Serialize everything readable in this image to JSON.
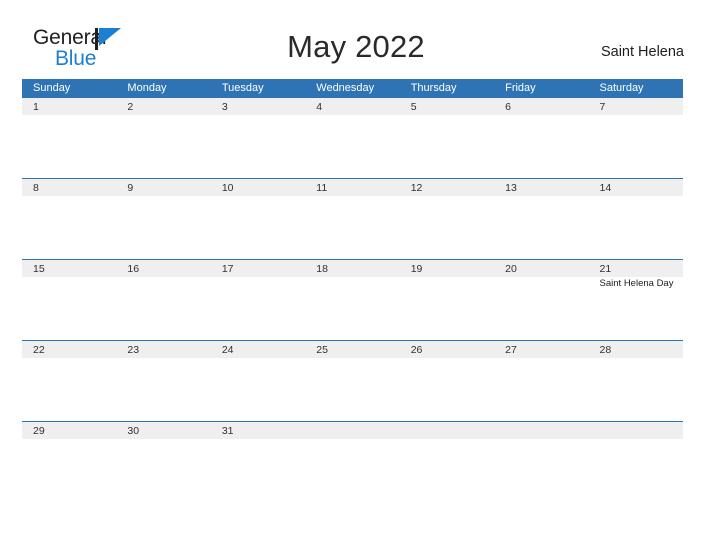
{
  "brand": {
    "name_top": "General",
    "name_bottom": "Blue",
    "flag_color": "#1b7fd4",
    "text_color": "#231f20"
  },
  "header": {
    "title": "May 2022",
    "region": "Saint Helena"
  },
  "theme": {
    "header_blue": "#2e74b5",
    "band_gray": "#efefef",
    "text_dark": "#303030"
  },
  "calendar": {
    "weekdays": [
      "Sunday",
      "Monday",
      "Tuesday",
      "Wednesday",
      "Thursday",
      "Friday",
      "Saturday"
    ],
    "weeks": [
      [
        {
          "day": "1",
          "events": []
        },
        {
          "day": "2",
          "events": []
        },
        {
          "day": "3",
          "events": []
        },
        {
          "day": "4",
          "events": []
        },
        {
          "day": "5",
          "events": []
        },
        {
          "day": "6",
          "events": []
        },
        {
          "day": "7",
          "events": []
        }
      ],
      [
        {
          "day": "8",
          "events": []
        },
        {
          "day": "9",
          "events": []
        },
        {
          "day": "10",
          "events": []
        },
        {
          "day": "11",
          "events": []
        },
        {
          "day": "12",
          "events": []
        },
        {
          "day": "13",
          "events": []
        },
        {
          "day": "14",
          "events": []
        }
      ],
      [
        {
          "day": "15",
          "events": []
        },
        {
          "day": "16",
          "events": []
        },
        {
          "day": "17",
          "events": []
        },
        {
          "day": "18",
          "events": []
        },
        {
          "day": "19",
          "events": []
        },
        {
          "day": "20",
          "events": []
        },
        {
          "day": "21",
          "events": [
            "Saint Helena Day"
          ]
        }
      ],
      [
        {
          "day": "22",
          "events": []
        },
        {
          "day": "23",
          "events": []
        },
        {
          "day": "24",
          "events": []
        },
        {
          "day": "25",
          "events": []
        },
        {
          "day": "26",
          "events": []
        },
        {
          "day": "27",
          "events": []
        },
        {
          "day": "28",
          "events": []
        }
      ],
      [
        {
          "day": "29",
          "events": []
        },
        {
          "day": "30",
          "events": []
        },
        {
          "day": "31",
          "events": []
        },
        {
          "day": "",
          "events": []
        },
        {
          "day": "",
          "events": []
        },
        {
          "day": "",
          "events": []
        },
        {
          "day": "",
          "events": []
        }
      ]
    ]
  }
}
